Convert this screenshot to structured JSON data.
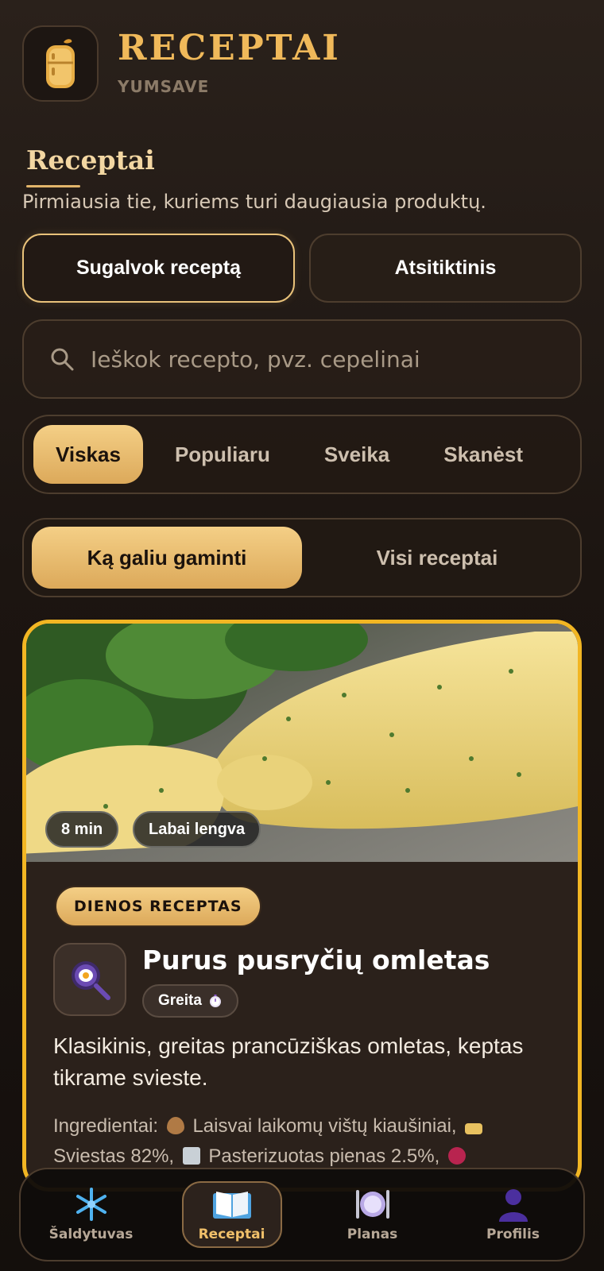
{
  "header": {
    "title": "RECEPTAI",
    "subtitle": "YUMSAVE",
    "logo_icon": "fridge-icon"
  },
  "section": {
    "title": "Receptai",
    "subtitle": "Pirmiausia tie, kuriems turi daugiausia produktų."
  },
  "actions": {
    "generate_label": "Sugalvok receptą",
    "random_label": "Atsitiktinis"
  },
  "search": {
    "placeholder": "Ieškok recepto, pvz. cepelinai",
    "icon": "search-icon"
  },
  "filters": {
    "items": [
      "Viskas",
      "Populiaru",
      "Sveika",
      "Skanėst"
    ],
    "active_index": 0
  },
  "mode_toggle": {
    "options": [
      "Ką galiu gaminti",
      "Visi receptai"
    ],
    "active_index": 0
  },
  "recipe_card": {
    "time_badge": "8 min",
    "difficulty_badge": "Labai lengva",
    "daily_label": "DIENOS RECEPTAS",
    "icon": "frying-pan-egg-icon",
    "title": "Purus pusryčių omletas",
    "tag": "Greita",
    "tag_icon": "stopwatch-icon",
    "description": "Klasikinis, greitas prancūziškas omletas, keptas tikrame svieste.",
    "ingredients_label": "Ingredientai:",
    "ingredients": [
      "Laisvai laikomų vištų kiaušiniai,",
      "Sviestas 82%,",
      "Pasterizuotas pienas 2.5%,"
    ],
    "border_color": "#f2b623"
  },
  "bottom_nav": {
    "items": [
      {
        "label": "Šaldytuvas",
        "icon": "snowflake-icon"
      },
      {
        "label": "Receptai",
        "icon": "open-book-icon"
      },
      {
        "label": "Planas",
        "icon": "plate-cutlery-icon"
      },
      {
        "label": "Profilis",
        "icon": "person-icon"
      }
    ],
    "active_index": 1
  },
  "colors": {
    "accent": "#f0b95a",
    "background": "#1c1511",
    "card_border": "#f2b623"
  }
}
